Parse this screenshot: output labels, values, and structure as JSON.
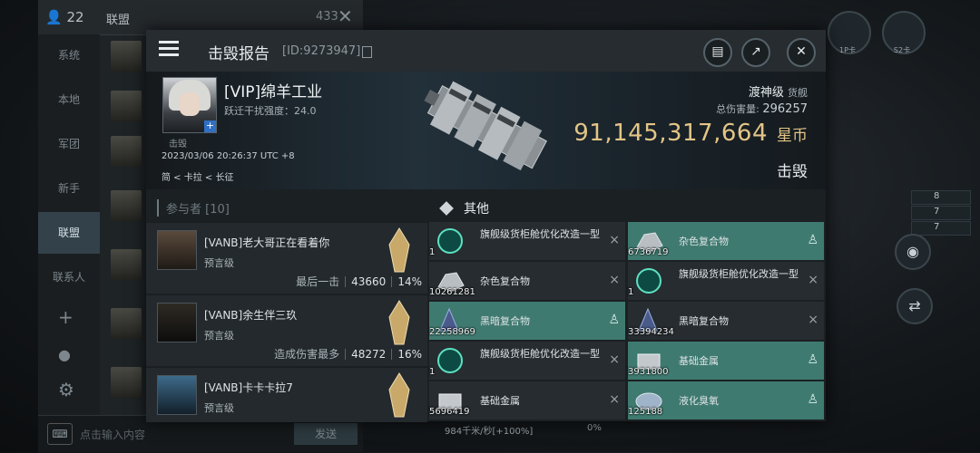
{
  "chat": {
    "user_count": "22",
    "title": "联盟",
    "unread_count": "433",
    "channels": [
      "系统",
      "本地",
      "军团",
      "新手",
      "联盟",
      "联系人"
    ],
    "active_channel": "联盟",
    "input_placeholder": "点击输入内容",
    "send_label": "发送"
  },
  "hud": {
    "stats": [
      "8",
      "7",
      "7"
    ],
    "speed": "984千米/秒[+100%]",
    "percent": "0%",
    "labels": [
      "1P卡",
      "S2卡"
    ]
  },
  "report": {
    "title": "击毁报告",
    "id": "[ID:9273947]"
  },
  "victim": {
    "tag": "击毁",
    "name": "[VIP]绵羊工业",
    "warp": "跃迁干扰强度：24.0",
    "time": "2023/03/06 20:26:37 UTC +8",
    "location": "简 < 卡拉 < 长征",
    "ship_class": "渡神级",
    "ship_type": "货舰",
    "total_damage_label": "总伤害量:",
    "total_damage": "296257",
    "isk_value": "91,145,317,664",
    "isk_unit": "星币",
    "result": "击毁"
  },
  "participants": {
    "header": "参与者 [10]",
    "rows": [
      {
        "name": "[VANB]老大哥正在看着你",
        "ship": "预言级",
        "note": "最后一击",
        "damage": "43660",
        "percent": "14%"
      },
      {
        "name": "[VANB]余生伴三玖",
        "ship": "预言级",
        "note": "造成伤害最多",
        "damage": "48272",
        "percent": "16%"
      },
      {
        "name": "[VANB]卡卡卡拉7",
        "ship": "预言级",
        "note": "",
        "damage": "",
        "percent": ""
      }
    ]
  },
  "others": {
    "header": "其他",
    "items": [
      {
        "name": "旗舰级货柜舱优化改造一型",
        "qty": "1",
        "status": "×",
        "dropped": false
      },
      {
        "name": "杂色复合物",
        "qty": "6736719",
        "status": "person",
        "dropped": true
      },
      {
        "name": "杂色复合物",
        "qty": "10261281",
        "status": "×",
        "dropped": false
      },
      {
        "name": "旗舰级货柜舱优化改造一型",
        "qty": "1",
        "status": "×",
        "dropped": false
      },
      {
        "name": "黑暗复合物",
        "qty": "22258969",
        "status": "person",
        "dropped": true
      },
      {
        "name": "黑暗复合物",
        "qty": "33394234",
        "status": "×",
        "dropped": false
      },
      {
        "name": "旗舰级货柜舱优化改造一型",
        "qty": "1",
        "status": "×",
        "dropped": false
      },
      {
        "name": "基础金属",
        "qty": "3931800",
        "status": "person",
        "dropped": true
      },
      {
        "name": "基础金属",
        "qty": "5696419",
        "status": "×",
        "dropped": false
      },
      {
        "name": "液化臭氧",
        "qty": "125188",
        "status": "person",
        "dropped": true
      }
    ]
  },
  "colors": {
    "accent_teal": "#3f7a70",
    "isk_gold": "#e3c586",
    "panel_bg": "#1b2023"
  },
  "icons": [
    "user-icon",
    "close-icon",
    "menu-icon",
    "copy-icon",
    "clipboard-icon",
    "share-icon",
    "plus-icon",
    "cube-icon",
    "person-icon",
    "keyboard-icon",
    "eye-icon",
    "swap-icon",
    "gear-icon"
  ]
}
